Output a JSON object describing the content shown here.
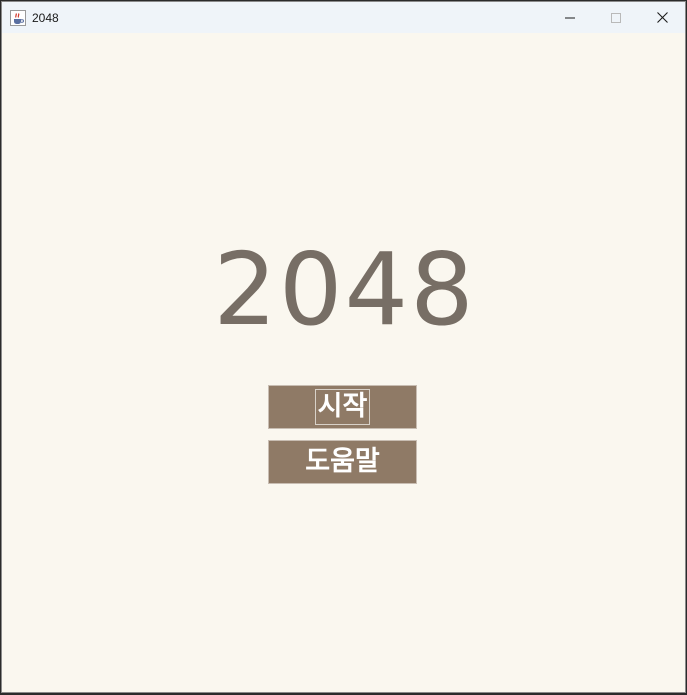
{
  "window": {
    "title": "2048",
    "app_icon": "java-cup-icon",
    "controls": {
      "minimize_icon": "minimize-icon",
      "maximize_icon": "maximize-icon",
      "close_icon": "close-icon"
    }
  },
  "main": {
    "logo": "2048",
    "buttons": {
      "start_label": "시작",
      "help_label": "도움말"
    }
  },
  "colors": {
    "background": "#faf7ef",
    "logo_text": "#776e65",
    "button_bg": "#8f7a66",
    "button_text": "#ffffff"
  }
}
